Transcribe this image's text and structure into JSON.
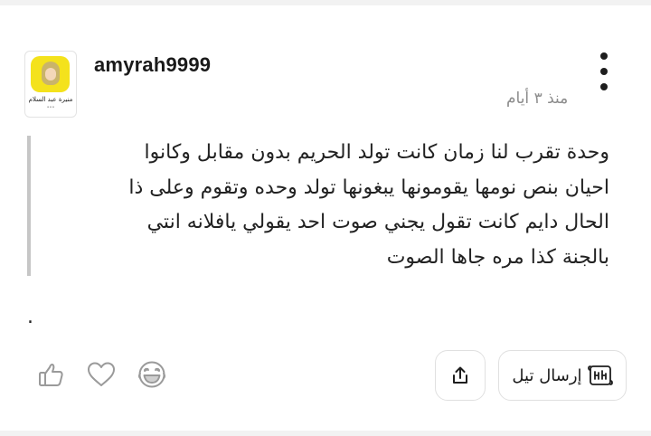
{
  "post": {
    "author": {
      "username": "amyrah9999",
      "avatar_caption": "منيرة عبد السلام",
      "avatar_subcaption": "•••"
    },
    "time_ago": "منذ ٣ أيام",
    "body_lines": [
      "وحدة تقرب لنا زمان كانت تولد الحريم بدون مقابل وكانوا",
      "احيان بنص نومها يقومونها يبغونها تولد وحده وتقوم وعلى ذا",
      "الحال دايم كانت تقول يجني صوت احد يقولي يافلانه انتي",
      "بالجنة كذا مره جاها الصوت"
    ],
    "trailing_text": "."
  },
  "actions": {
    "send_tale_label": "إرسال تيل",
    "icons": {
      "like": "thumbs-up-icon",
      "love": "heart-icon",
      "laugh": "laughing-face-icon",
      "share": "share-icon",
      "tale": "scroll-card-icon",
      "more": "more-vertical-icon"
    }
  },
  "colors": {
    "text": "#222222",
    "muted": "#8c8c8c",
    "icon_gray": "#9a9a9a",
    "quote_bar": "#c6c6c6",
    "snap_yellow": "#f4e21c"
  }
}
